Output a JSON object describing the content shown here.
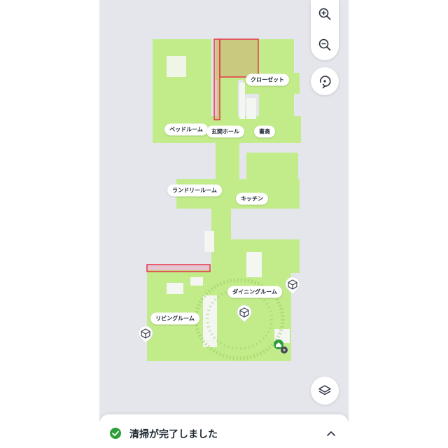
{
  "rooms": [
    {
      "id": "closet",
      "label": "クローゼット"
    },
    {
      "id": "bedroom",
      "label": "ベッドルーム"
    },
    {
      "id": "entrance",
      "label": "玄関ホール"
    },
    {
      "id": "study",
      "label": "書斎"
    },
    {
      "id": "laundry",
      "label": "ランドリールーム"
    },
    {
      "id": "kitchen",
      "label": "キッチン"
    },
    {
      "id": "dining",
      "label": "ダイニングルーム"
    },
    {
      "id": "living",
      "label": "リビングルーム"
    }
  ],
  "controls": {
    "zoom_in_icon": "zoom-in-icon",
    "zoom_out_icon": "zoom-out-icon",
    "rotate_icon": "rotate-icon",
    "layers_icon": "layers-icon"
  },
  "status": {
    "text": "清掃が完了しました",
    "check_color": "#2e9e3a"
  },
  "colors": {
    "floor": "#c2ec8a",
    "background": "#e4e6ec",
    "no_go_zone": "#e8344e",
    "dock": "#2e9e3a"
  }
}
